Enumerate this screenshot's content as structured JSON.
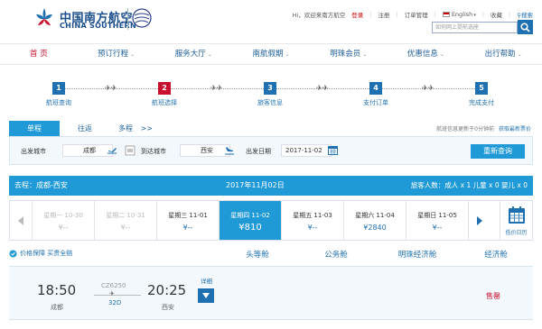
{
  "header": {
    "logo_cn": "中国南方航空",
    "logo_en": "CHINA SOUTHERN",
    "greeting": "Hi，欢迎来南方航空",
    "login": "登录",
    "register": "注册",
    "order_mgmt": "订单管理",
    "language": "English",
    "favorite": "收藏",
    "search_btn": "搜索",
    "search_placeholder": "如何网上提前选座"
  },
  "nav": {
    "items": [
      {
        "label": "首 页"
      },
      {
        "label": "预订行程"
      },
      {
        "label": "服务大厅"
      },
      {
        "label": "南航假期"
      },
      {
        "label": "明珠会员"
      },
      {
        "label": "优惠信息"
      },
      {
        "label": "出行帮助"
      }
    ]
  },
  "steps": [
    {
      "num": "1",
      "label": "航班查询"
    },
    {
      "num": "2",
      "label": "航班选择"
    },
    {
      "num": "3",
      "label": "旅客信息"
    },
    {
      "num": "4",
      "label": "支付订单"
    },
    {
      "num": "5",
      "label": "完成支付"
    }
  ],
  "search": {
    "tabs": [
      {
        "label": "单程"
      },
      {
        "label": "往返"
      },
      {
        "label": "多程"
      }
    ],
    "multi_arrow": ">>",
    "note": "航班信息更新于0分钟前",
    "latest": "获取最新票价",
    "from_label": "出发城市",
    "from_value": "成都",
    "to_label": "到达城市",
    "to_value": "西安",
    "date_label": "出发日期",
    "date_value": "2017-11-02",
    "research": "重新查询"
  },
  "itinerary": {
    "route": "去程：成都-西安",
    "date": "2017年11月02日",
    "pax": "旅客人数：成人 x 1   儿童 x 0   婴儿 x 0"
  },
  "dates": [
    {
      "day": "星期一  10-30",
      "price": "¥--"
    },
    {
      "day": "星期二  10-31",
      "price": "¥--"
    },
    {
      "day": "星期三  11-01",
      "price": "¥--"
    },
    {
      "day": "星期四  11-02",
      "price": "¥810"
    },
    {
      "day": "星期五  11-03",
      "price": "¥--"
    },
    {
      "day": "星期六  11-04",
      "price": "¥2840"
    },
    {
      "day": "星期日  11-05",
      "price": "¥--"
    }
  ],
  "calendar_label": "低价日历",
  "price_guard": "价格保障 买贵全赔",
  "cabins": [
    {
      "label": "头等舱"
    },
    {
      "label": "公务舱"
    },
    {
      "label": "明珠经济舱"
    },
    {
      "label": "经济舱"
    }
  ],
  "flight": {
    "dep_time": "18:50",
    "dep_city": "成都",
    "flight_no": "CZ6250",
    "aircraft": "32D",
    "arr_time": "20:25",
    "arr_city": "西安",
    "detail": "详细",
    "status": "售罄"
  },
  "colors": {
    "brand_blue": "#1f9ad6",
    "dark_blue": "#1f70b0",
    "accent_red": "#c8102e"
  }
}
